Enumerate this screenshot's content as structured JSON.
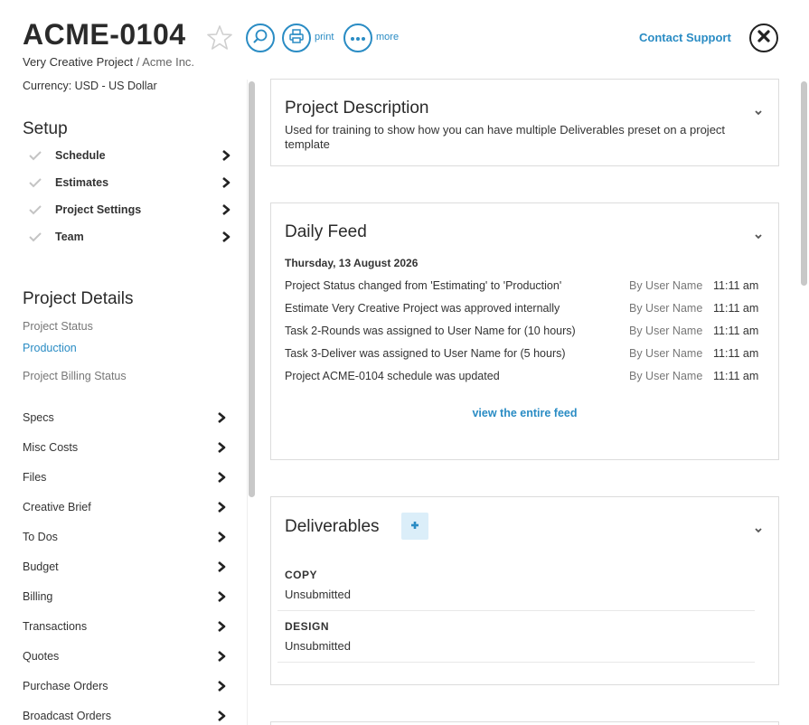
{
  "header": {
    "project_code": "ACME-0104",
    "project_name": "Very Creative Project",
    "separator": " / ",
    "client": "Acme Inc.",
    "print_label": "print",
    "more_label": "more",
    "contact_label": "Contact Support",
    "accent": "#2a8cc4"
  },
  "sidebar": {
    "currency": "Currency: USD - US Dollar",
    "setup_title": "Setup",
    "setup_items": [
      {
        "label": "Schedule"
      },
      {
        "label": "Estimates"
      },
      {
        "label": "Project Settings"
      },
      {
        "label": "Team"
      }
    ],
    "details_title": "Project Details",
    "project_status_label": "Project Status",
    "project_status_value": "Production",
    "billing_status_label": "Project Billing Status",
    "nav_items": [
      {
        "label": "Specs"
      },
      {
        "label": "Misc Costs"
      },
      {
        "label": "Files"
      },
      {
        "label": "Creative Brief"
      },
      {
        "label": "To Dos"
      },
      {
        "label": "Budget"
      },
      {
        "label": "Billing"
      },
      {
        "label": "Transactions"
      },
      {
        "label": "Quotes"
      },
      {
        "label": "Purchase Orders"
      },
      {
        "label": "Broadcast Orders"
      }
    ]
  },
  "description": {
    "title": "Project Description",
    "text": "Used for training to show how you can have multiple Deliverables preset on a project template"
  },
  "feed": {
    "title": "Daily Feed",
    "date": "Thursday, 13 August 2026",
    "rows": [
      {
        "message": "Project Status changed from 'Estimating' to 'Production'",
        "by": "By User Name",
        "time": "11:11 am"
      },
      {
        "message": "Estimate Very Creative Project was approved internally",
        "by": "By User Name",
        "time": "11:11 am"
      },
      {
        "message": "Task 2-Rounds was assigned to User Name for (10 hours)",
        "by": "By User Name",
        "time": "11:11 am"
      },
      {
        "message": "Task 3-Deliver was assigned to User Name for (5 hours)",
        "by": "By User Name",
        "time": "11:11 am"
      },
      {
        "message": "Project ACME-0104 schedule was updated",
        "by": "By User Name",
        "time": "11:11 am"
      }
    ],
    "view_all": "view the entire feed"
  },
  "deliverables": {
    "title": "Deliverables",
    "items": [
      {
        "name": "COPY",
        "status": "Unsubmitted"
      },
      {
        "name": "DESIGN",
        "status": "Unsubmitted"
      }
    ]
  }
}
